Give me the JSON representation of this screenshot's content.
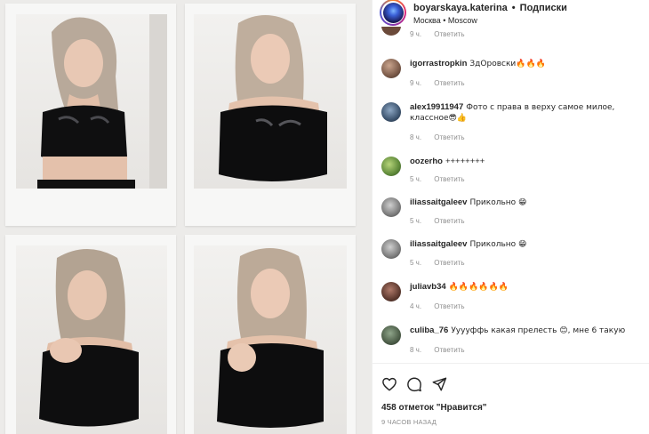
{
  "post": {
    "username": "boyarskaya.katerina",
    "separator": "•",
    "follow_label": "Подписки",
    "location": "Москва • Moscow"
  },
  "comments": [
    {
      "user": "",
      "text": "",
      "time": "9 ч.",
      "reply": "Ответить"
    },
    {
      "user": "igorrastropkin",
      "text": "ЗдОровски🔥🔥🔥",
      "time": "9 ч.",
      "reply": "Ответить"
    },
    {
      "user": "alex19911947",
      "text": "Фото с права в верху самое милое, классное😎👍",
      "time": "8 ч.",
      "reply": "Ответить"
    },
    {
      "user": "oozerho",
      "text": "++++++++",
      "time": "5 ч.",
      "reply": "Ответить"
    },
    {
      "user": "iliassaitgaleev",
      "text": "Прикольно 😁",
      "time": "5 ч.",
      "reply": "Ответить"
    },
    {
      "user": "iliassaitgaleev",
      "text": "Прикольно 😁",
      "time": "5 ч.",
      "reply": "Ответить"
    },
    {
      "user": "juliavb34",
      "text": "🔥🔥🔥🔥🔥🔥",
      "time": "4 ч.",
      "reply": "Ответить"
    },
    {
      "user": "culiba_76",
      "text": "Ууууффь какая прелесть 😊, мне 6 такую",
      "time": "8 ч.",
      "reply": "Ответить"
    }
  ],
  "actions": {
    "like_icon": "heart-icon",
    "comment_icon": "comment-bubble-icon",
    "share_icon": "paper-plane-icon",
    "likes_text": "458 отметок \"Нравится\"",
    "time_ago": "9 ЧАСОВ НАЗАД"
  },
  "colors": {
    "text": "#262626",
    "secondary": "#8e8e8e",
    "divider": "#efefef"
  }
}
